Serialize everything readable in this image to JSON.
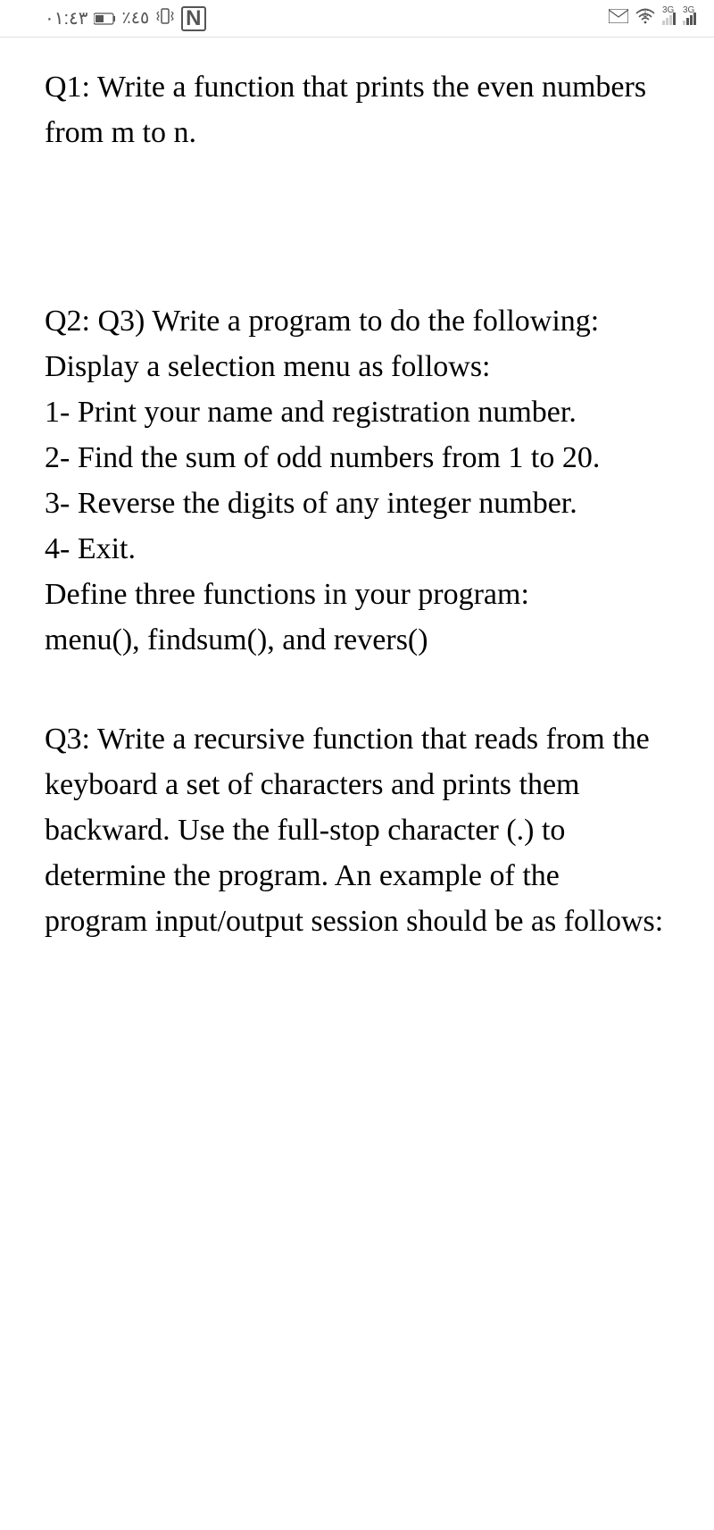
{
  "status_bar": {
    "time": "٠١:٤٣",
    "battery_percent": "٪٤٥",
    "network_label_1": "3G",
    "network_label_2": "3G"
  },
  "questions": {
    "q1": "Q1: Write a function that prints the even numbers from m to n.",
    "q2": {
      "intro": "Q2: Q3) Write a program to do the following: Display a selection menu as follows:",
      "item1": "1- Print your name and registration number.",
      "item2": "2- Find the sum of odd numbers from 1 to 20.",
      "item3": "3- Reverse the digits of any integer number.",
      "item4": "4- Exit.",
      "define": "Define three functions in your program:",
      "funcs": "menu(), findsum(), and revers()"
    },
    "q3": "Q3: Write a recursive function that reads from the keyboard a set of characters and prints them backward. Use the full-stop character (.) to determine the program. An example of the program input/output session should be as follows:"
  }
}
